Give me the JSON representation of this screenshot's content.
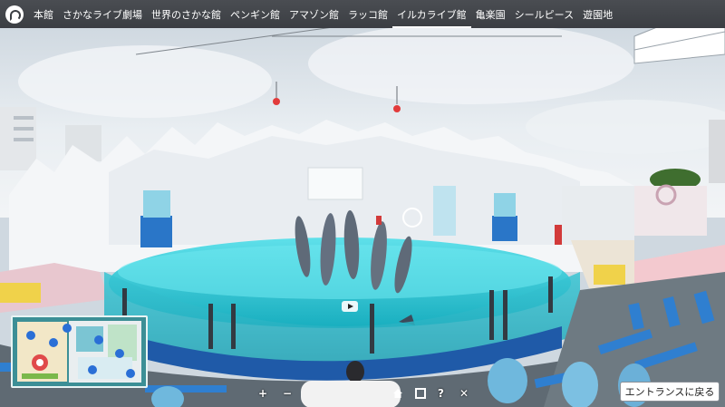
{
  "nav": {
    "items": [
      {
        "label": "本館",
        "active": false
      },
      {
        "label": "さかなライブ劇場",
        "active": false
      },
      {
        "label": "世界のさかな館",
        "active": false
      },
      {
        "label": "ペンギン館",
        "active": false
      },
      {
        "label": "アマゾン館",
        "active": false
      },
      {
        "label": "ラッコ館",
        "active": false
      },
      {
        "label": "イルカライブ館",
        "active": true
      },
      {
        "label": "亀楽園",
        "active": false
      },
      {
        "label": "シールピース",
        "active": false
      },
      {
        "label": "遊園地",
        "active": false
      }
    ]
  },
  "icons": {
    "logo": "aquarium-logo-icon",
    "play": "play-video-icon",
    "zoom_in": "plus-icon",
    "zoom_out": "minus-icon",
    "home": "home-icon",
    "fullscreen": "fullscreen-icon",
    "help": "help-icon",
    "close": "close-icon"
  },
  "controls": {
    "zoom_in": "+",
    "zoom_out": "−",
    "help": "?",
    "close": "✕"
  },
  "entrance_button": {
    "label": "エントランスに戻る"
  },
  "colors": {
    "nav_bg": "#3b3e43",
    "pool_water": "#2fc7d6",
    "pool_rim": "#1f5aa8",
    "stage_white": "#f4f7fa",
    "seats_blue": "#2f7fd0"
  }
}
